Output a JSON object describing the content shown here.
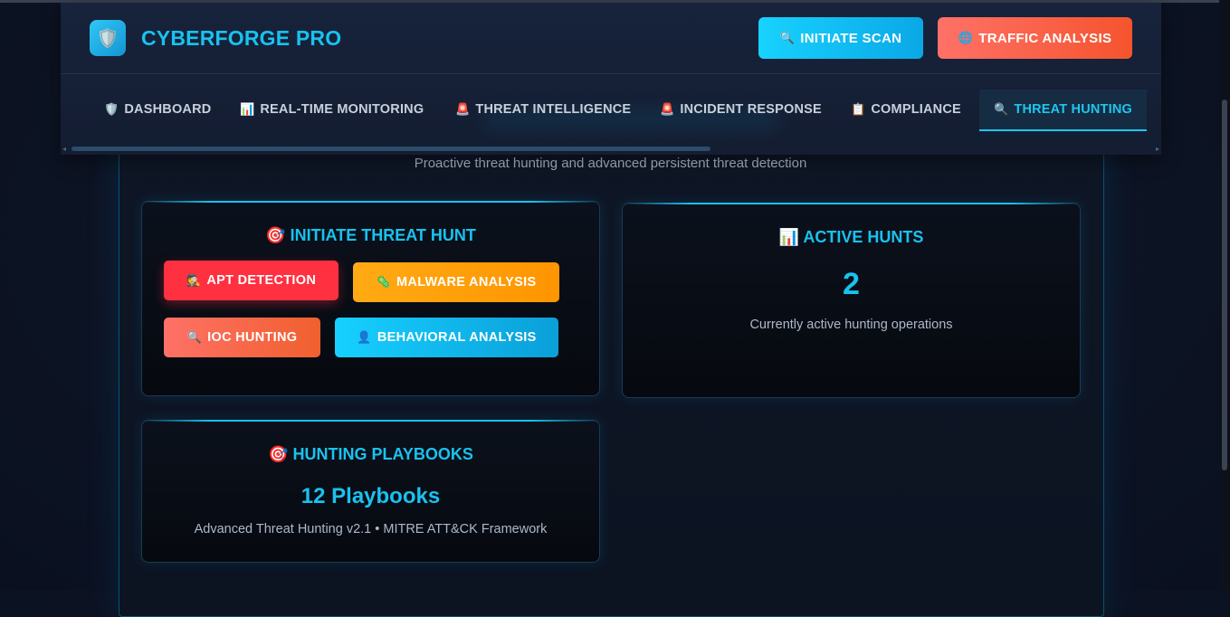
{
  "app": {
    "logo_icon": "🛡️",
    "title": "CYBERFORGE PRO"
  },
  "header_actions": {
    "scan_icon": "🔍",
    "scan_label": "INITIATE SCAN",
    "traffic_icon": "🌐",
    "traffic_label": "TRAFFIC ANALYSIS"
  },
  "tabs": [
    {
      "icon": "🛡️",
      "label": "DASHBOARD",
      "active": false
    },
    {
      "icon": "📊",
      "label": "REAL-TIME MONITORING",
      "active": false
    },
    {
      "icon": "🚨",
      "label": "THREAT INTELLIGENCE",
      "active": false
    },
    {
      "icon": "🚨",
      "label": "INCIDENT RESPONSE",
      "active": false
    },
    {
      "icon": "📋",
      "label": "COMPLIANCE",
      "active": false
    },
    {
      "icon": "🔍",
      "label": "THREAT HUNTING",
      "active": true
    }
  ],
  "page": {
    "subtitle": "Proactive threat hunting and advanced persistent threat detection"
  },
  "initiate_hunt": {
    "icon": "🎯",
    "title": "INITIATE THREAT HUNT",
    "buttons": [
      {
        "icon": "🕵️",
        "label": "APT DETECTION"
      },
      {
        "icon": "🦠",
        "label": "MALWARE ANALYSIS"
      },
      {
        "icon": "🔍",
        "label": "IOC HUNTING"
      },
      {
        "icon": "👤",
        "label": "BEHAVIORAL ANALYSIS"
      }
    ]
  },
  "active_hunts": {
    "icon": "📊",
    "title": "ACTIVE HUNTS",
    "value": "2",
    "description": "Currently active hunting operations"
  },
  "playbooks": {
    "icon": "🎯",
    "title": "HUNTING PLAYBOOKS",
    "value": "12 Playbooks",
    "description": "Advanced Threat Hunting v2.1 • MITRE ATT&CK Framework"
  },
  "colors": {
    "accent": "#19c2ef",
    "danger": "#ff3040",
    "warning": "#ffaa14",
    "coral": "#ff7167"
  }
}
